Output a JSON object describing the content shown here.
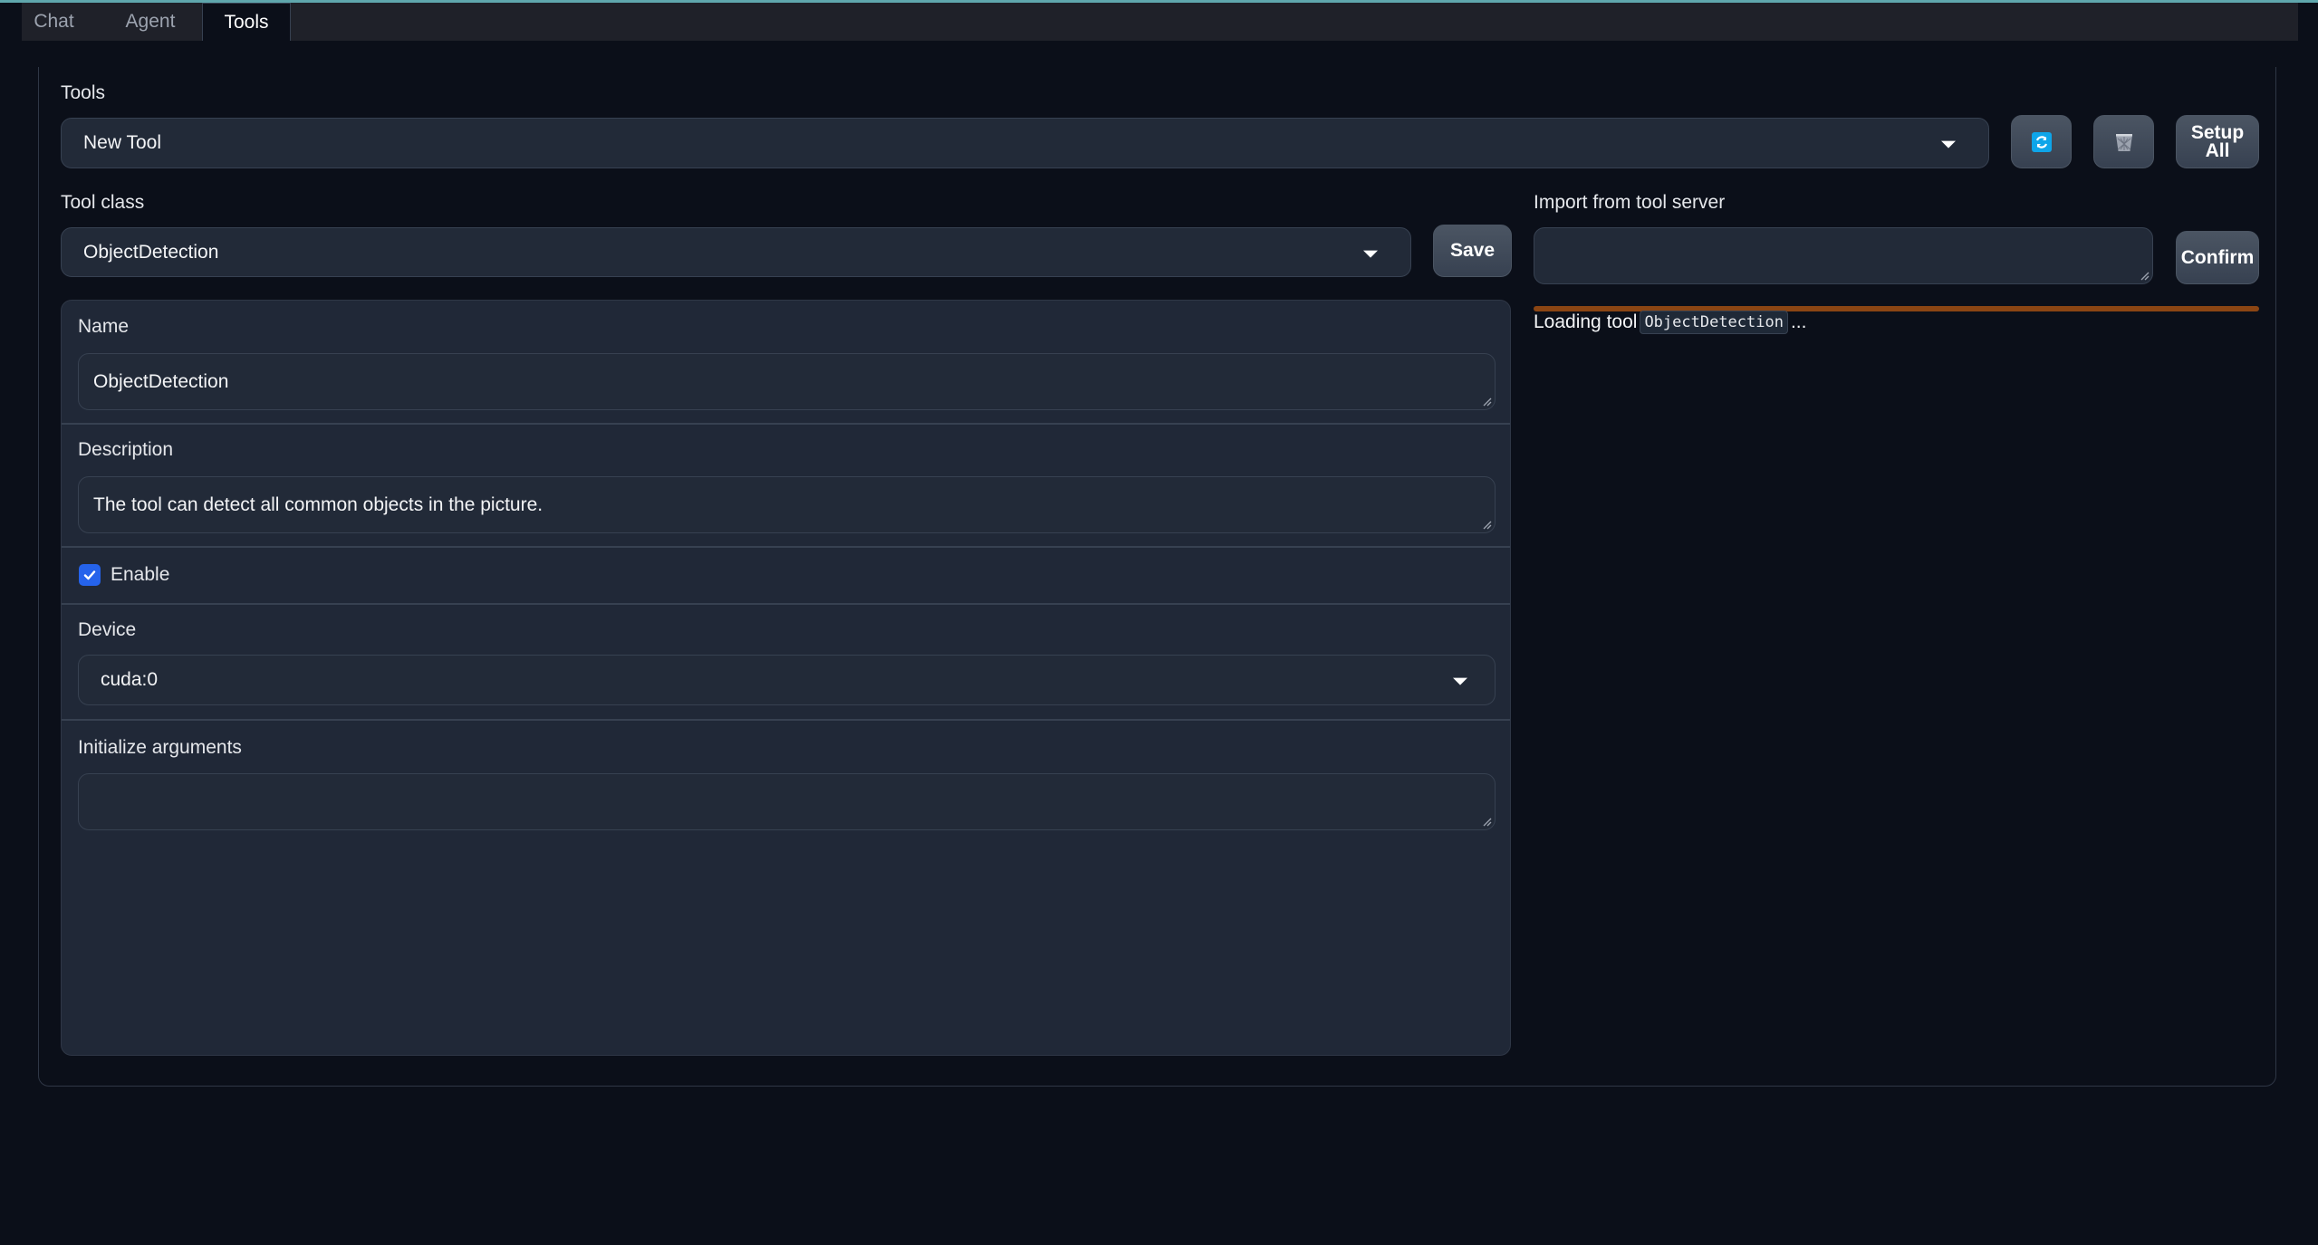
{
  "tabs": [
    {
      "label": "Chat",
      "active": false
    },
    {
      "label": "Agent",
      "active": false
    },
    {
      "label": "Tools",
      "active": true
    }
  ],
  "tools_section": {
    "label": "Tools",
    "selected_tool": "New Tool",
    "refresh_icon": "refresh-icon",
    "delete_icon": "trash-icon",
    "setup_all_label": "Setup All"
  },
  "tool_class": {
    "label": "Tool class",
    "selected": "ObjectDetection",
    "save_label": "Save"
  },
  "import": {
    "label": "Import from tool server",
    "value": "",
    "confirm_label": "Confirm",
    "progress_percent": 100,
    "progress_color": "#8b4513",
    "loading_prefix": "Loading tool",
    "loading_tool": "ObjectDetection",
    "loading_suffix": "..."
  },
  "form": {
    "name_label": "Name",
    "name_value": "ObjectDetection",
    "description_label": "Description",
    "description_value": "The tool can detect all common objects in the picture.",
    "enable_label": "Enable",
    "enable_checked": true,
    "device_label": "Device",
    "device_value": "cuda:0",
    "init_args_label": "Initialize arguments",
    "init_args_value": ""
  },
  "colors": {
    "accent_line": "#5fa7ad",
    "checkbox": "#2563eb",
    "background": "#0b0f19"
  }
}
